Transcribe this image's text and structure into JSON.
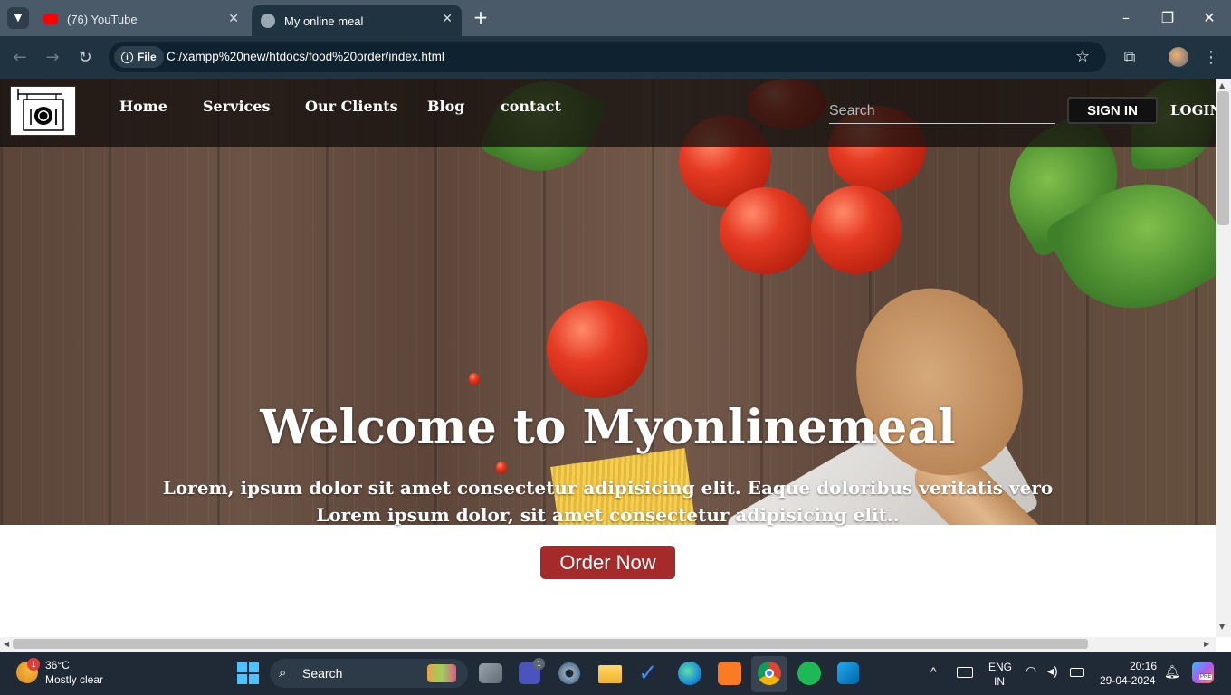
{
  "browser": {
    "tabs": [
      {
        "title": "(76) YouTube",
        "active": false
      },
      {
        "title": "My online meal",
        "active": true
      }
    ],
    "new_tab": "+",
    "address": {
      "scheme_chip": "File",
      "url": "C:/xampp%20new/htdocs/food%20order/index.html"
    }
  },
  "site": {
    "nav": [
      "Home",
      "Services",
      "Our Clients",
      "Blog",
      "contact"
    ],
    "search_placeholder": "Search",
    "signin_label": "SIGN IN",
    "login_label": "LOGIN",
    "hero": {
      "title": "Welcome to Myonlinemeal",
      "line1": "Lorem, ipsum dolor sit amet consectetur adipisicing elit. Eaque doloribus veritatis vero",
      "line2": "Lorem ipsum dolor, sit amet consectetur adipisicing elit.."
    },
    "order_button": "Order Now"
  },
  "taskbar": {
    "weather": {
      "temp": "36°C",
      "condition": "Mostly clear",
      "badge": "1"
    },
    "search_label": "Search",
    "teams_badge": "1",
    "lang": {
      "line1": "ENG",
      "line2": "IN"
    },
    "clock": {
      "time": "20:16",
      "date": "29-04-2024"
    },
    "copilot_badge": "PRE"
  },
  "colors": {
    "order_button": "#a52a2a",
    "tab_strip": "#4a5a68",
    "toolbar": "#1f3340",
    "taskbar": "#1f2a36"
  }
}
